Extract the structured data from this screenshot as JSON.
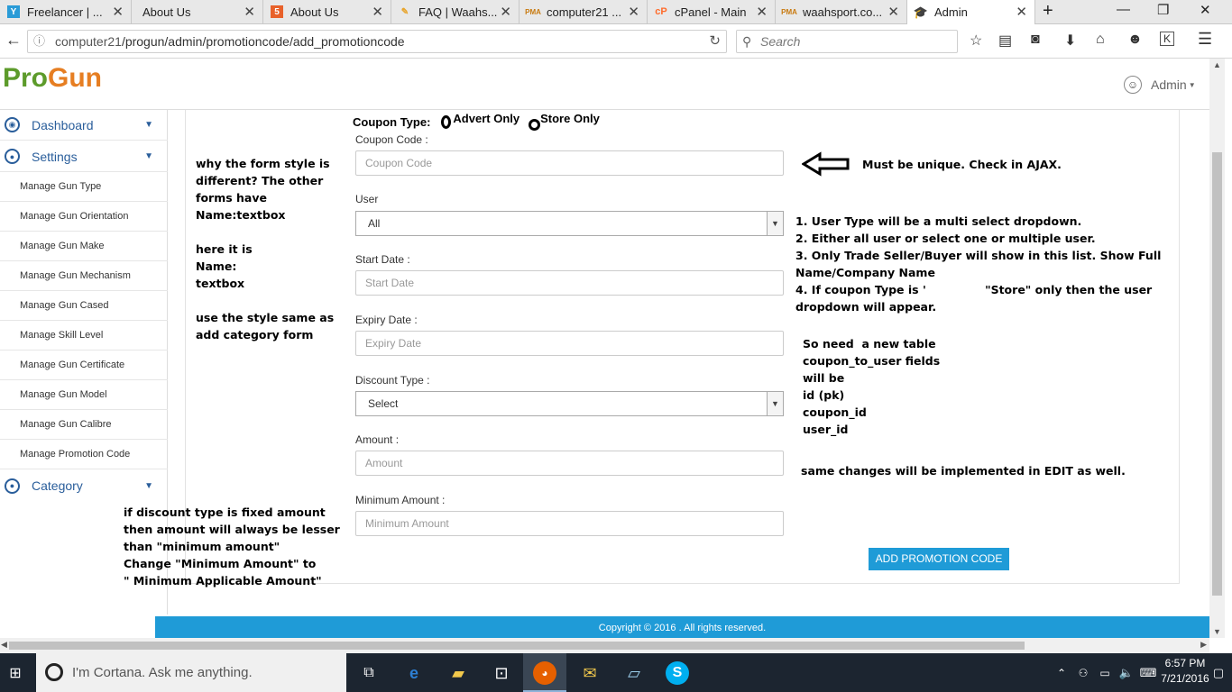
{
  "browser": {
    "tabs": [
      {
        "label": "Freelancer | ...",
        "favicon": "freelancer-icon",
        "color": "#2a9bd7"
      },
      {
        "label": "About Us",
        "favicon": "blank-page-icon",
        "color": "#888888"
      },
      {
        "label": "About Us",
        "favicon": "html-icon",
        "color": "#e8612a"
      },
      {
        "label": "FAQ | Waahs...",
        "favicon": "faq-icon",
        "color": "#e8a42a"
      },
      {
        "label": "computer21 ...",
        "favicon": "pma-icon",
        "color": "#f0a030"
      },
      {
        "label": "cPanel - Main",
        "favicon": "cpanel-icon",
        "color": "#ff6c2c"
      },
      {
        "label": "waahsport.co...",
        "favicon": "pma-icon",
        "color": "#f0a030"
      },
      {
        "label": "Admin",
        "favicon": "graduation-cap-icon",
        "color": "#2a5e9b"
      }
    ],
    "url_host": "computer21",
    "url_path": "/progun/admin/promotioncode/add_promotioncode",
    "search_placeholder": "Search"
  },
  "app": {
    "brand_pro": "Pro",
    "brand_gun": "Gun",
    "admin_label": "Admin",
    "footer": "Copyright © 2016 . All rights reserved."
  },
  "sidebar": {
    "dashboard": "Dashboard",
    "settings": "Settings",
    "items": [
      "Manage Gun Type",
      "Manage Gun Orientation",
      "Manage Gun Make",
      "Manage Gun Mechanism",
      "Manage Gun Cased",
      "Manage Skill Level",
      "Manage Gun Certificate",
      "Manage Gun Model",
      "Manage Gun Calibre",
      "Manage Promotion Code"
    ],
    "category": "Category"
  },
  "form": {
    "coupon_type_label": "Coupon Type:",
    "coupon_type_options": [
      "Advert Only",
      "Store Only"
    ],
    "coupon_code_label": "Coupon Code :",
    "coupon_code_placeholder": "Coupon Code",
    "user_label": "User",
    "user_selected": "All",
    "start_date_label": "Start Date :",
    "start_date_placeholder": "Start Date",
    "expiry_date_label": "Expiry Date :",
    "expiry_date_placeholder": "Expiry Date",
    "discount_type_label": "Discount Type :",
    "discount_type_selected": "Select",
    "amount_label": "Amount :",
    "amount_placeholder": "Amount",
    "minimum_amount_label": "Minimum Amount :",
    "minimum_amount_placeholder": "Minimum Amount",
    "submit_label": "ADD PROMOTION CODE"
  },
  "annotations": {
    "left_note": "why the form style is\ndifferent? The other\nforms have\nName:textbox\n\nhere it is\nName:\ntextbox\n\nuse the style same as\nadd category form",
    "unique_note": "Must be unique. Check in AJAX.",
    "user_type_note": "1. User Type will be a multi select dropdown.\n2. Either all user or select one or multiple user.\n3. Only Trade Seller/Buyer will show in this list. Show Full\nName/Company Name\n4. If coupon Type is '               \"Store\" only then the user\ndropdown will appear.",
    "table_note": "So need  a new table\ncoupon_to_user fields\nwill be\nid (pk)\ncoupon_id\nuser_id",
    "edit_note": "same changes will be implemented in EDIT as well.",
    "discount_note": "if discount type is fixed amount\nthen amount will always be lesser\nthan \"minimum amount\"\nChange \"Minimum Amount\" to\n\" Minimum Applicable Amount\""
  },
  "taskbar": {
    "cortana_placeholder": "I'm Cortana. Ask me anything.",
    "time": "6:57 PM",
    "date": "7/21/2016"
  }
}
